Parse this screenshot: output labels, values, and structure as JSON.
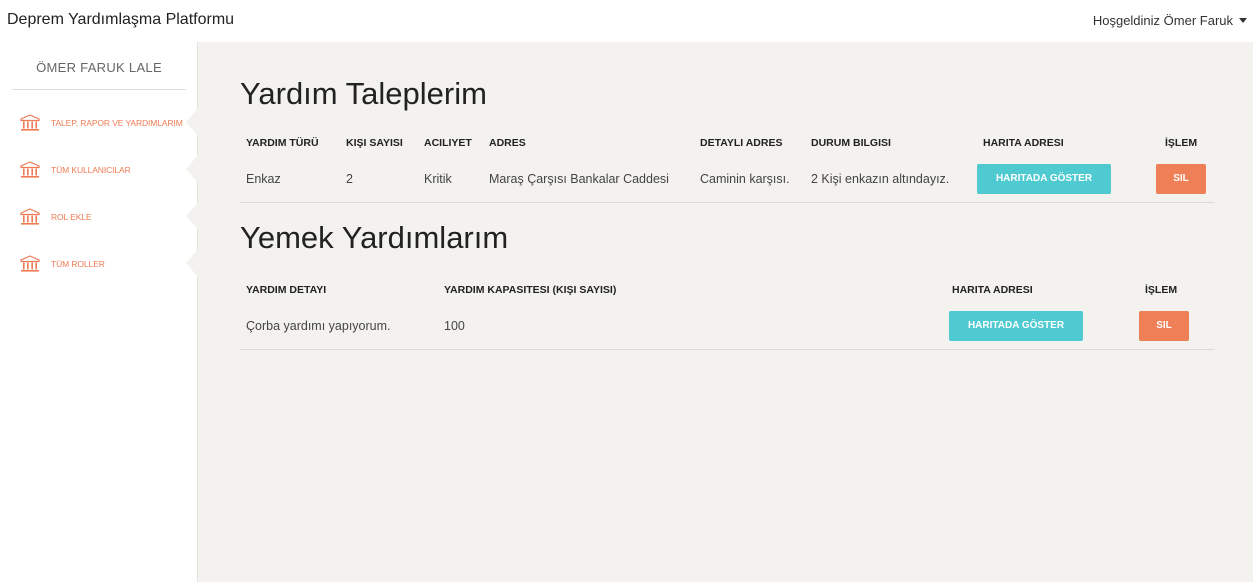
{
  "header": {
    "brand": "Deprem Yardımlaşma Platformu",
    "welcome": "Hoşgeldiniz Ömer Faruk"
  },
  "sidebar": {
    "user_name": "ÖMER FARUK LALE",
    "items": [
      {
        "label": "TALEP, RAPOR VE YARDIMLARIM",
        "icon": "bank-icon"
      },
      {
        "label": "TÜM KULLANICILAR",
        "icon": "bank-icon"
      },
      {
        "label": "ROL EKLE",
        "icon": "bank-icon"
      },
      {
        "label": "TÜM ROLLER",
        "icon": "bank-icon"
      }
    ]
  },
  "requests": {
    "title": "Yardım Taleplerim",
    "headers": [
      "YARDIM TÜRÜ",
      "KIŞI SAYISI",
      "ACILIYET",
      "ADRES",
      "DETAYLI ADRES",
      "DURUM BILGISI",
      "HARITA ADRESI",
      "İŞLEM"
    ],
    "rows": [
      {
        "type": "Enkaz",
        "count": "2",
        "urgency": "Kritik",
        "address": "Maraş Çarşısı Bankalar Caddesi",
        "detail_address": "Caminin karşısı.",
        "status": "2 Kişi enkazın altındayız.",
        "map_button": "HARITADA GÖSTER",
        "delete_button": "SIL"
      }
    ]
  },
  "food": {
    "title": "Yemek Yardımlarım",
    "headers": [
      "YARDIM DETAYI",
      "YARDIM KAPASITESI (KIŞI SAYISI)",
      "HARITA ADRESI",
      "İŞLEM"
    ],
    "rows": [
      {
        "detail": "Çorba yardımı yapıyorum.",
        "capacity": "100",
        "map_button": "HARITADA GÖSTER",
        "delete_button": "SIL"
      }
    ]
  },
  "colors": {
    "accent": "#ee7b54",
    "map_button": "#4ecad0",
    "delete_button": "#ef7f57",
    "content_bg": "#f3f2ef"
  }
}
